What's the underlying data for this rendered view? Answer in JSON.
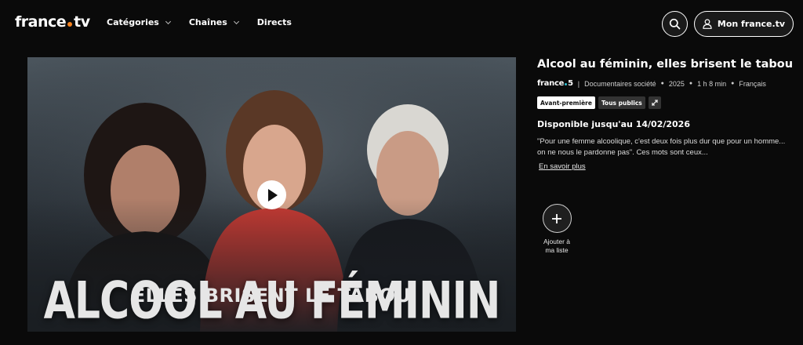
{
  "header": {
    "logo_left": "france",
    "logo_right": "tv",
    "nav": [
      {
        "label": "Catégories",
        "has_dropdown": true
      },
      {
        "label": "Chaînes",
        "has_dropdown": true
      },
      {
        "label": "Directs",
        "has_dropdown": false
      }
    ],
    "search_icon": "search-icon",
    "account_label": "Mon france.tv",
    "account_icon": "user-icon"
  },
  "poster": {
    "title_line1": "ALCOOL AU FÉMININ",
    "title_line2": "ELLES BRISENT LE TABOU",
    "play_icon": "play-icon"
  },
  "program": {
    "title": "Alcool au féminin, elles brisent le tabou",
    "channel_left": "france",
    "channel_right": "5",
    "category": "Documentaires société",
    "year": "2025",
    "duration": "1 h 8 min",
    "language": "Français",
    "tags": [
      "Avant-première",
      "Tous publics"
    ],
    "accessibility_icon": "audio-description-icon",
    "availability": "Disponible jusqu'au 14/02/2026",
    "description": "\"Pour une femme alcoolique, c'est deux fois plus dur que pour un homme... on ne nous le pardonne pas\". Ces mots sont ceux...",
    "more_link": "En savoir plus",
    "add_label_line1": "Ajouter à",
    "add_label_line2": "ma liste"
  },
  "colors": {
    "background": "#0a0a0a",
    "logo_dot": "#f5821f",
    "channel_dot": "#2ec4d6"
  }
}
